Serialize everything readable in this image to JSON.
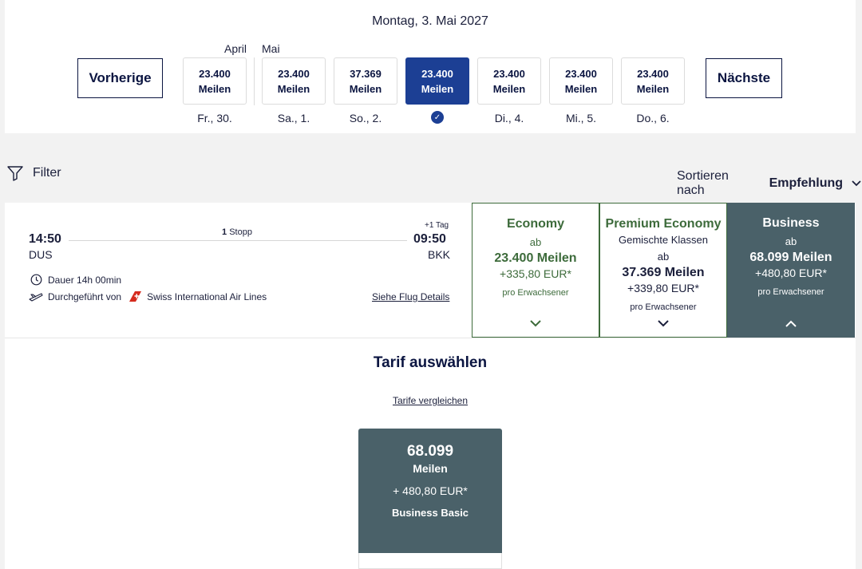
{
  "header": {
    "date_title": "Montag, 3. Mai 2027",
    "prev_label": "Vorherige",
    "next_label": "Nächste",
    "month_prev": "April",
    "month_next": "Mai"
  },
  "days": [
    {
      "miles": "23.400",
      "unit": "Meilen",
      "label": "Fr., 30."
    },
    {
      "miles": "23.400",
      "unit": "Meilen",
      "label": "Sa., 1."
    },
    {
      "miles": "37.369",
      "unit": "Meilen",
      "label": "So., 2."
    },
    {
      "miles": "23.400",
      "unit": "Meilen",
      "label": ""
    },
    {
      "miles": "23.400",
      "unit": "Meilen",
      "label": "Di., 4."
    },
    {
      "miles": "23.400",
      "unit": "Meilen",
      "label": "Mi., 5."
    },
    {
      "miles": "23.400",
      "unit": "Meilen",
      "label": "Do., 6."
    }
  ],
  "filter_bar": {
    "filter_label": "Filter",
    "sort_label": "Sortieren nach",
    "sort_value": "Empfehlung"
  },
  "flight": {
    "dep_time": "14:50",
    "dep_airport": "DUS",
    "arr_time": "09:50",
    "arr_airport": "BKK",
    "day_offset": "+1 Tag",
    "stops_count": "1",
    "stops_label": "Stopp",
    "duration": "Dauer 14h 00min",
    "operated_by": "Durchgeführt von",
    "airline": "Swiss International Air Lines",
    "details_link": "Siehe Flug Details"
  },
  "fares": {
    "economy": {
      "name": "Economy",
      "ab": "ab",
      "miles": "23.400 Meilen",
      "eur": "+335,80 EUR*",
      "per": "pro Erwachsener"
    },
    "premium": {
      "name": "Premium Economy",
      "sub": "Gemischte Klassen",
      "ab": "ab",
      "miles": "37.369 Meilen",
      "eur": "+339,80 EUR*",
      "per": "pro Erwachsener"
    },
    "business": {
      "name": "Business",
      "ab": "ab",
      "miles": "68.099 Meilen",
      "eur": "+480,80 EUR*",
      "per": "pro Erwachsener"
    }
  },
  "tarif": {
    "title": "Tarif auswählen",
    "compare_link": "Tarife vergleichen",
    "card_miles": "68.099",
    "card_unit": "Meilen",
    "card_eur": "+ 480,80 EUR*",
    "card_name": "Business Basic"
  },
  "colors": {
    "accent": "#1c3f94",
    "economy_green": "#3d6b3b",
    "business_slate": "#4a6169",
    "swiss_red": "#d52b1e"
  }
}
